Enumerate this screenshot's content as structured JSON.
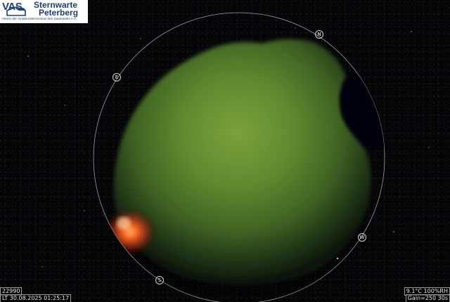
{
  "logo": {
    "abbr": "VAS",
    "name_line1": "Sternwarte",
    "name_line2": "Peterberg",
    "subtitle": "Verein der Amateurastronomen des Saarlandes e.V."
  },
  "compass": {
    "north": "N",
    "east": "E",
    "south": "S",
    "west": "W"
  },
  "overlay": {
    "frame_number": "22990",
    "local_time": "LT 30.08.2025 01:25:17",
    "weather": "9.1°C 100%RH",
    "camera": "Gain=250 30s"
  },
  "colors": {
    "background": "#050507",
    "sky_glow": "#5f8a2f",
    "horizon_glow": "#ff5a1a",
    "logo_blue": "#1c3d78"
  }
}
